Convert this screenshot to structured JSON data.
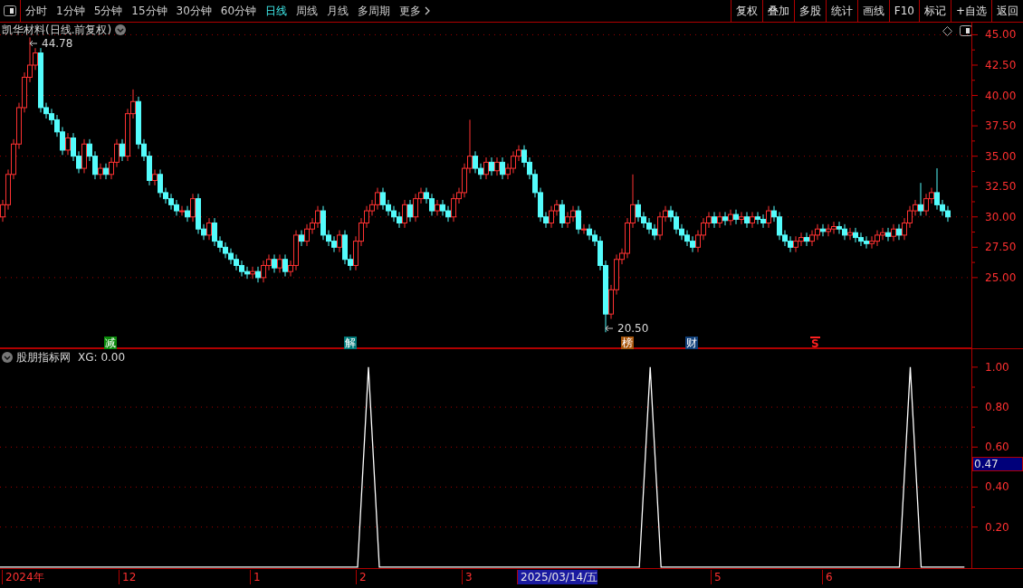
{
  "toolbar": {
    "periods": [
      {
        "label": "分时",
        "selected": false
      },
      {
        "label": "1分钟",
        "selected": false
      },
      {
        "label": "5分钟",
        "selected": false
      },
      {
        "label": "15分钟",
        "selected": false
      },
      {
        "label": "30分钟",
        "selected": false
      },
      {
        "label": "60分钟",
        "selected": false
      },
      {
        "label": "日线",
        "selected": true
      },
      {
        "label": "周线",
        "selected": false
      },
      {
        "label": "月线",
        "selected": false
      },
      {
        "label": "多周期",
        "selected": false
      }
    ],
    "more": "更多",
    "buttons": [
      "复权",
      "叠加",
      "多股",
      "统计",
      "画线",
      "F10",
      "标记",
      "+自选",
      "返回"
    ]
  },
  "price_panel": {
    "title": "凯华材料(日线.前复权)",
    "high_label": "44.78",
    "low_label": "20.50",
    "event_marks": [
      {
        "text": "减",
        "kind": "badge",
        "color": "#0a8a0a"
      },
      {
        "text": "解",
        "kind": "badge",
        "color": "#007a7a"
      },
      {
        "text": "榜",
        "kind": "badge",
        "color": "#a8560c"
      },
      {
        "text": "财",
        "kind": "badge",
        "color": "#10407a"
      },
      {
        "text": "S",
        "kind": "flag",
        "color": "#ff2020"
      }
    ],
    "chart_data": {
      "type": "candlestick",
      "ylim": [
        19.18,
        46
      ],
      "grid": true,
      "yticks": [
        {
          "value": 45,
          "label": "45.00"
        },
        {
          "value": 42.5,
          "label": "42.50"
        },
        {
          "value": 40,
          "label": "40.00"
        },
        {
          "value": 37.5,
          "label": "37.50"
        },
        {
          "value": 35,
          "label": "35.00"
        },
        {
          "value": 32.5,
          "label": "32.50"
        },
        {
          "value": 30,
          "label": "30.00"
        },
        {
          "value": 27.5,
          "label": "27.50"
        },
        {
          "value": 25,
          "label": "25.00"
        }
      ],
      "ohlc": [
        [
          30,
          31.4,
          29.6,
          31
        ],
        [
          31,
          33.9,
          30.6,
          33.5
        ],
        [
          33.5,
          36.4,
          33.1,
          36
        ],
        [
          36,
          39.4,
          35.6,
          39
        ],
        [
          39,
          41.9,
          38.6,
          41.5
        ],
        [
          41.5,
          44.78,
          41.1,
          42.5
        ],
        [
          42.5,
          43.9,
          42.1,
          43.5
        ],
        [
          43.5,
          43.9,
          38.6,
          39
        ],
        [
          39,
          39.4,
          38.1,
          38.5
        ],
        [
          38.5,
          38.9,
          37.6,
          38
        ],
        [
          38,
          38.4,
          36.6,
          37
        ],
        [
          37,
          37.4,
          35.1,
          35.5
        ],
        [
          35.5,
          36.9,
          35.1,
          36.5
        ],
        [
          36.5,
          36.9,
          34.6,
          35
        ],
        [
          35,
          35.4,
          33.6,
          34
        ],
        [
          34,
          36.4,
          33.6,
          36
        ],
        [
          36,
          36.4,
          34.6,
          35
        ],
        [
          35,
          35.4,
          33.1,
          33.5
        ],
        [
          33.5,
          34.4,
          33.1,
          34
        ],
        [
          34,
          34.4,
          33.1,
          33.5
        ],
        [
          33.5,
          34.9,
          33.1,
          34.5
        ],
        [
          34.5,
          36.4,
          34.1,
          36
        ],
        [
          36,
          36.4,
          34.6,
          35
        ],
        [
          35,
          38.9,
          34.6,
          38.5
        ],
        [
          38.5,
          40.5,
          38.1,
          39.5
        ],
        [
          39.5,
          39.9,
          35.6,
          36
        ],
        [
          36,
          36.4,
          34.6,
          35
        ],
        [
          35,
          35.4,
          32.6,
          33
        ],
        [
          33,
          33.9,
          32.6,
          33.5
        ],
        [
          33.5,
          33.9,
          31.6,
          32
        ],
        [
          32,
          32.4,
          31.1,
          31.5
        ],
        [
          31.5,
          31.9,
          30.6,
          31
        ],
        [
          31,
          31.4,
          30.1,
          30.5
        ],
        [
          30.5,
          30.9,
          30.1,
          30.5
        ],
        [
          30.5,
          30.9,
          29.6,
          30
        ],
        [
          30,
          31.9,
          29.6,
          31.5
        ],
        [
          31.5,
          31.9,
          28.6,
          29
        ],
        [
          29,
          29.4,
          28.1,
          28.5
        ],
        [
          28.5,
          29.9,
          28.1,
          29.5
        ],
        [
          29.5,
          29.9,
          27.6,
          28
        ],
        [
          28,
          28.4,
          27.1,
          27.5
        ],
        [
          27.5,
          27.9,
          26.6,
          27
        ],
        [
          27,
          27.4,
          26.1,
          26.5
        ],
        [
          26.5,
          26.9,
          25.6,
          26
        ],
        [
          26,
          26.4,
          25.1,
          25.5
        ],
        [
          25.5,
          25.9,
          24.9,
          25.3
        ],
        [
          25.3,
          25.9,
          24.9,
          25.5
        ],
        [
          25.5,
          25.9,
          24.6,
          25
        ],
        [
          25,
          26.4,
          24.6,
          26
        ],
        [
          26,
          26.9,
          25.6,
          26.5
        ],
        [
          26.5,
          26.9,
          25.4,
          25.8
        ],
        [
          25.8,
          26.9,
          25.4,
          26.5
        ],
        [
          26.5,
          26.9,
          25.1,
          25.5
        ],
        [
          25.5,
          26.4,
          25.1,
          26
        ],
        [
          26,
          28.9,
          25.6,
          28.5
        ],
        [
          28.5,
          28.9,
          27.6,
          28
        ],
        [
          28,
          29.4,
          27.6,
          29
        ],
        [
          29,
          29.9,
          28.6,
          29.5
        ],
        [
          29.5,
          30.9,
          29.1,
          30.5
        ],
        [
          30.5,
          30.9,
          28.1,
          28.5
        ],
        [
          28.5,
          28.9,
          27.6,
          28
        ],
        [
          28,
          28.4,
          27.1,
          27.5
        ],
        [
          27.5,
          28.9,
          27.1,
          28.5
        ],
        [
          28.5,
          28.9,
          26.1,
          26.5
        ],
        [
          26.5,
          26.9,
          25.6,
          26
        ],
        [
          26,
          28.4,
          25.6,
          28
        ],
        [
          28,
          29.9,
          27.6,
          29.5
        ],
        [
          29.5,
          30.9,
          29.1,
          30.5
        ],
        [
          30.5,
          31.4,
          30.1,
          31
        ],
        [
          31,
          32.4,
          30.6,
          32
        ],
        [
          32,
          32.4,
          30.6,
          31
        ],
        [
          31,
          31.4,
          30.1,
          30.5
        ],
        [
          30.5,
          30.9,
          29.6,
          30
        ],
        [
          30,
          30.4,
          29.1,
          29.5
        ],
        [
          29.5,
          31.4,
          29.1,
          31
        ],
        [
          31,
          31.4,
          29.6,
          30
        ],
        [
          30,
          31.9,
          29.6,
          31.5
        ],
        [
          31.5,
          32.4,
          31.1,
          32
        ],
        [
          32,
          32.4,
          31.1,
          31.5
        ],
        [
          31.5,
          31.9,
          30.1,
          30.5
        ],
        [
          30.5,
          31.4,
          30.1,
          31
        ],
        [
          31,
          31.4,
          30.1,
          30.5
        ],
        [
          30.5,
          30.9,
          29.6,
          30
        ],
        [
          30,
          31.9,
          29.6,
          31.5
        ],
        [
          31.5,
          32.4,
          31.1,
          32
        ],
        [
          32,
          34.4,
          31.6,
          34
        ],
        [
          34,
          38,
          33.6,
          35
        ],
        [
          35,
          35.4,
          33.6,
          34
        ],
        [
          34,
          34.4,
          33.1,
          33.5
        ],
        [
          33.5,
          34.9,
          33.1,
          34.5
        ],
        [
          34.5,
          34.9,
          33.4,
          33.8
        ],
        [
          33.8,
          34.9,
          33.4,
          34.5
        ],
        [
          34.5,
          34.9,
          33.1,
          33.5
        ],
        [
          33.5,
          34.4,
          33.1,
          34
        ],
        [
          34,
          35.4,
          33.6,
          35
        ],
        [
          35,
          35.9,
          34.6,
          35.5
        ],
        [
          35.5,
          35.9,
          34.1,
          34.5
        ],
        [
          34.5,
          34.9,
          33.1,
          33.5
        ],
        [
          33.5,
          33.9,
          31.6,
          32
        ],
        [
          32,
          32.4,
          29.6,
          30
        ],
        [
          30,
          30.4,
          29.1,
          29.5
        ],
        [
          29.5,
          30.9,
          29.1,
          30.5
        ],
        [
          30.5,
          31.4,
          30.1,
          31
        ],
        [
          31,
          31.4,
          29.1,
          29.5
        ],
        [
          29.5,
          30.4,
          29.1,
          30
        ],
        [
          30,
          30.9,
          29.6,
          30.5
        ],
        [
          30.5,
          30.9,
          28.6,
          29
        ],
        [
          29,
          29.4,
          28.6,
          29
        ],
        [
          29,
          29.4,
          28.1,
          28.5
        ],
        [
          28.5,
          28.9,
          27.6,
          28
        ],
        [
          28,
          28.4,
          25.6,
          26
        ],
        [
          26,
          26.4,
          20.5,
          22
        ],
        [
          22,
          24.4,
          21.6,
          24
        ],
        [
          24,
          26.9,
          23.6,
          26.5
        ],
        [
          26.5,
          27.4,
          26.1,
          27
        ],
        [
          27,
          29.9,
          26.6,
          29.5
        ],
        [
          29.5,
          33.5,
          29.1,
          31
        ],
        [
          31,
          31.4,
          29.6,
          30
        ],
        [
          30,
          30.4,
          29.1,
          29.5
        ],
        [
          29.5,
          29.9,
          28.6,
          29
        ],
        [
          29,
          29.4,
          28.1,
          28.5
        ],
        [
          28.5,
          30.4,
          28.1,
          30
        ],
        [
          30,
          30.9,
          29.6,
          30.5
        ],
        [
          30.5,
          30.9,
          29.6,
          30
        ],
        [
          30,
          30.4,
          28.6,
          29
        ],
        [
          29,
          29.4,
          28.1,
          28.5
        ],
        [
          28.5,
          28.9,
          27.6,
          28
        ],
        [
          28,
          28.4,
          27.1,
          27.5
        ],
        [
          27.5,
          28.9,
          27.1,
          28.5
        ],
        [
          28.5,
          29.9,
          28.1,
          29.5
        ],
        [
          29.5,
          30.4,
          29.1,
          30
        ],
        [
          30,
          30.4,
          29.1,
          29.5
        ],
        [
          29.5,
          30.4,
          29.1,
          30
        ],
        [
          30,
          30.4,
          29.3,
          29.7
        ],
        [
          29.7,
          30.6,
          29.3,
          30.2
        ],
        [
          30.2,
          30.6,
          29.4,
          29.8
        ],
        [
          29.8,
          30.4,
          29.4,
          30
        ],
        [
          30,
          30.4,
          29.1,
          29.5
        ],
        [
          29.5,
          30.4,
          29.1,
          30
        ],
        [
          30,
          30.4,
          29.4,
          29.8
        ],
        [
          29.8,
          30.2,
          29.1,
          29.5
        ],
        [
          29.5,
          30.9,
          29.1,
          30.5
        ],
        [
          30.5,
          30.9,
          29.6,
          30
        ],
        [
          30,
          30.4,
          28.1,
          28.5
        ],
        [
          28.5,
          28.9,
          27.6,
          28
        ],
        [
          28,
          28.4,
          27.1,
          27.5
        ],
        [
          27.5,
          28.4,
          27.1,
          28
        ],
        [
          28,
          28.7,
          27.6,
          28.3
        ],
        [
          28.3,
          28.7,
          27.6,
          28
        ],
        [
          28,
          28.9,
          27.6,
          28.5
        ],
        [
          28.5,
          29.4,
          28.1,
          29
        ],
        [
          29,
          29.4,
          28.4,
          28.8
        ],
        [
          28.8,
          29.4,
          28.4,
          29
        ],
        [
          29,
          29.6,
          28.6,
          29.2
        ],
        [
          29.2,
          29.6,
          28.6,
          29
        ],
        [
          29,
          29.4,
          28.1,
          28.5
        ],
        [
          28.5,
          29.1,
          28.1,
          28.7
        ],
        [
          28.7,
          29.1,
          27.9,
          28.3
        ],
        [
          28.3,
          28.7,
          27.6,
          28
        ],
        [
          28,
          28.4,
          27.4,
          27.8
        ],
        [
          27.8,
          28.4,
          27.4,
          28
        ],
        [
          28,
          28.9,
          27.6,
          28.5
        ],
        [
          28.5,
          29.1,
          28.1,
          28.7
        ],
        [
          28.7,
          29.1,
          28,
          28.4
        ],
        [
          28.4,
          29.4,
          28,
          29
        ],
        [
          29,
          29.4,
          28.1,
          28.5
        ],
        [
          28.5,
          29.9,
          28.1,
          29.5
        ],
        [
          29.5,
          30.9,
          29.1,
          30.5
        ],
        [
          30.5,
          31.4,
          30.1,
          31
        ],
        [
          31,
          32.8,
          30.1,
          30.5
        ],
        [
          30.5,
          31.9,
          30.1,
          31.5
        ],
        [
          31.5,
          32.4,
          31.1,
          32
        ],
        [
          32,
          34,
          30.6,
          31
        ],
        [
          31,
          31.4,
          30.1,
          30.5
        ],
        [
          30.5,
          30.9,
          29.6,
          30
        ]
      ]
    }
  },
  "indicator_panel": {
    "name": "股朋指标网",
    "reading": "XG: 0.00",
    "cursor_value": "0.47",
    "chart_data": {
      "type": "line",
      "ylim": [
        -0.01,
        1.09
      ],
      "grid": true,
      "yticks": [
        {
          "value": 0.2,
          "label": "0.20"
        },
        {
          "value": 0.4,
          "label": "0.40"
        },
        {
          "value": 0.6,
          "label": "0.60"
        },
        {
          "value": 0.8,
          "label": "0.80"
        },
        {
          "value": 1.0,
          "label": "1.00"
        }
      ],
      "series": [
        {
          "color": "#ffffff",
          "values": [
            0,
            0,
            0,
            0,
            0,
            0,
            0,
            0,
            0,
            0,
            0,
            0,
            0,
            0,
            0,
            0,
            0,
            0,
            0,
            0,
            0,
            0,
            0,
            0,
            0,
            0,
            0,
            0,
            0,
            0,
            0,
            0,
            0,
            0,
            1,
            0,
            0,
            0,
            0,
            0,
            0,
            0,
            0,
            0,
            0,
            0,
            0,
            0,
            0,
            0,
            0,
            0,
            0,
            0,
            0,
            0,
            0,
            0,
            0,
            0,
            1,
            0,
            0,
            0,
            0,
            0,
            0,
            0,
            0,
            0,
            0,
            0,
            0,
            0,
            0,
            0,
            0,
            0,
            0,
            0,
            0,
            0,
            0,
            0,
            1,
            0,
            0,
            0,
            0,
            0
          ]
        }
      ]
    }
  },
  "date_axis": {
    "labels": [
      {
        "text": "2024年",
        "selected": false
      },
      {
        "text": "12",
        "selected": false
      },
      {
        "text": "1",
        "selected": false
      },
      {
        "text": "2",
        "selected": false
      },
      {
        "text": "3",
        "selected": false
      },
      {
        "text": "2025/03/14/五",
        "selected": true
      },
      {
        "text": "5",
        "selected": false
      },
      {
        "text": "6",
        "selected": false
      }
    ]
  }
}
